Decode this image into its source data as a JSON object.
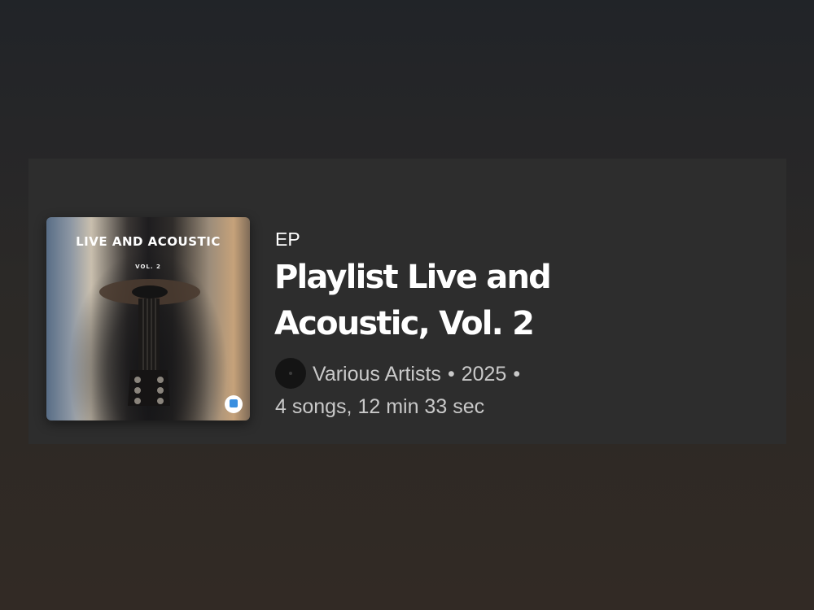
{
  "album": {
    "cover": {
      "title": "LIVE AND ACOUSTIC",
      "volume": "VOL. 2"
    },
    "type": "EP",
    "title": "Playlist Live and Acoustic, Vol. 2",
    "artist": "Various Artists",
    "separator": "•",
    "year": "2025",
    "summary": "4 songs, 12 min 33 sec"
  },
  "icons": {
    "artist_avatar": "avatar",
    "label_logo": "label-logo-icon"
  },
  "colors": {
    "card_background": "#2d2d2d",
    "title_text": "#ffffff",
    "meta_text": "#c9c9c9"
  }
}
